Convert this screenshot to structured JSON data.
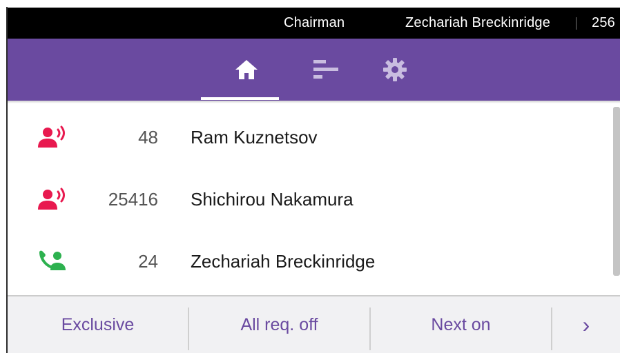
{
  "status_bar": {
    "role": "Chairman",
    "user": "Zechariah Breckinridge",
    "extension": "256"
  },
  "tabs": [
    {
      "icon": "home-icon",
      "active": true
    },
    {
      "icon": "list-icon",
      "active": false
    },
    {
      "icon": "gear-icon",
      "active": false
    }
  ],
  "participants": [
    {
      "icon": "speaking-participant-icon",
      "icon_color": "#e8194f",
      "extension": "48",
      "name": "Ram Kuznetsov"
    },
    {
      "icon": "speaking-participant-icon",
      "icon_color": "#e8194f",
      "extension": "25416",
      "name": "Shichirou Nakamura"
    },
    {
      "icon": "call-participant-icon",
      "icon_color": "#2db14f",
      "extension": "24",
      "name": "Zechariah Breckinridge"
    }
  ],
  "softkeys": {
    "exclusive": "Exclusive",
    "all_req_off": "All req. off",
    "next_on": "Next on",
    "more": "›"
  },
  "colors": {
    "accent": "#6a4aa0",
    "alert": "#e8194f",
    "active": "#2db14f"
  }
}
